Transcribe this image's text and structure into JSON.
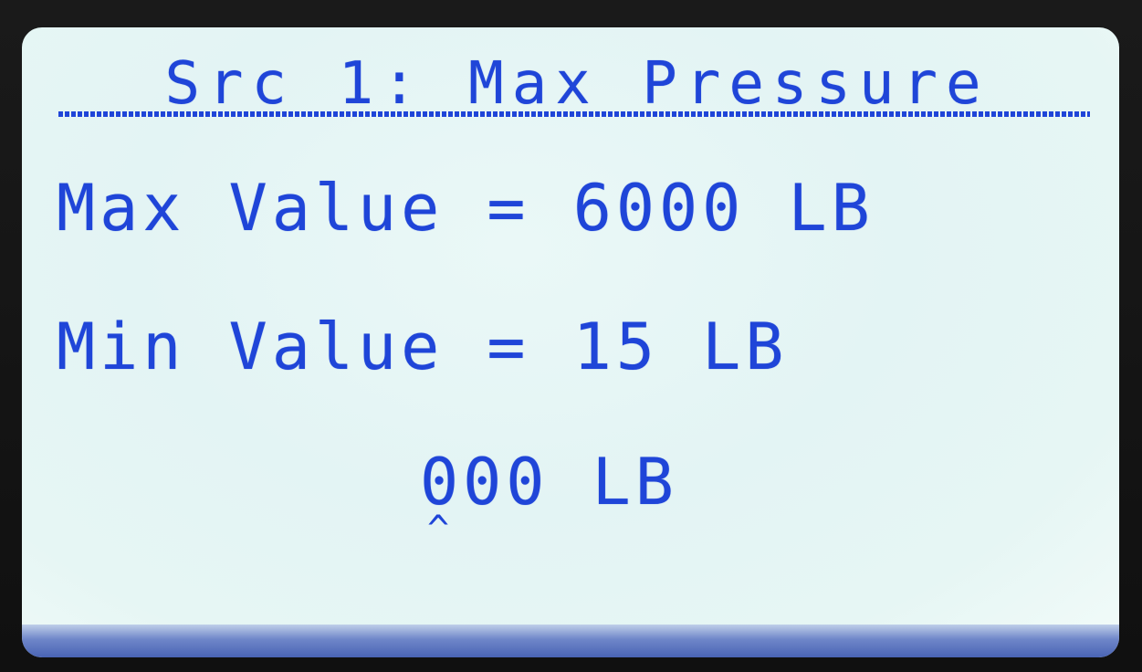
{
  "screen": {
    "title": "Src 1: Max Pressure",
    "max_row": "Max Value = 6000 LB",
    "min_row": "Min Value = 15 LB",
    "edit_value": "000 LB",
    "cursor": "^"
  },
  "colors": {
    "lcd_text": "#1f45d8",
    "lcd_background": "#e6f6f4",
    "bezel": "#101010"
  }
}
